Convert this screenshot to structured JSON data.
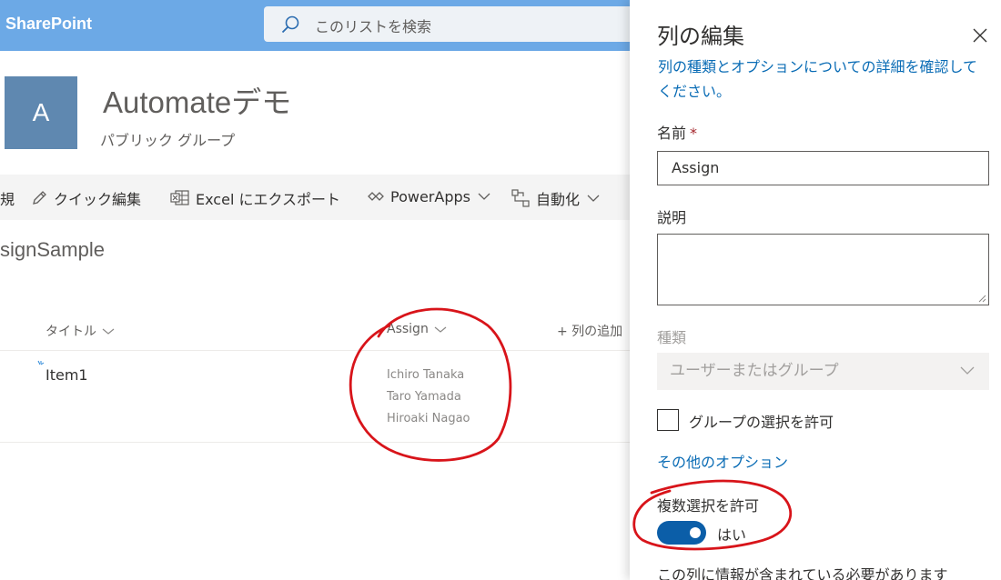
{
  "header": {
    "brand": "SharePoint",
    "search_placeholder": "このリストを検索"
  },
  "site": {
    "logo_letter": "A",
    "title": "Automateデモ",
    "subtitle": "パブリック グループ"
  },
  "commandbar": {
    "new_label": "規",
    "quick_edit_label": "クイック編集",
    "export_label": "Excel にエクスポート",
    "powerapps_label": "PowerApps",
    "automate_label": "自動化"
  },
  "list": {
    "title": "signSample",
    "columns": {
      "title_col": "タイトル",
      "assign_col": "Assign",
      "add_col": "+ 列の追加"
    },
    "rows": [
      {
        "title": "Item1",
        "assign": [
          "Ichiro Tanaka",
          "Taro Yamada",
          "Hiroaki Nagao"
        ]
      }
    ]
  },
  "panel": {
    "title": "列の編集",
    "help_link": "列の種類とオプションについての詳細を確認してください。",
    "name_label": "名前",
    "required_mark": "*",
    "name_value": "Assign",
    "description_label": "説明",
    "type_label": "種類",
    "type_value": "ユーザーまたはグループ",
    "allow_groups_label": "グループの選択を許可",
    "allow_groups_checked": false,
    "more_options_link": "その他のオプション",
    "allow_multiple_label": "複数選択を許可",
    "allow_multiple_on": true,
    "allow_multiple_state": "はい",
    "required_info_label": "この列に情報が含まれている必要があります"
  },
  "colors": {
    "topbar": "#6ca9e6",
    "site_logo": "#5f88b0",
    "link": "#0a6cb5",
    "toggle_on": "#0b5ea8",
    "annotation": "#d8141a"
  },
  "annotations": [
    {
      "type": "hand-drawn-circle",
      "target": "assign-column"
    },
    {
      "type": "hand-drawn-circle",
      "target": "allow-multiple-toggle"
    }
  ]
}
